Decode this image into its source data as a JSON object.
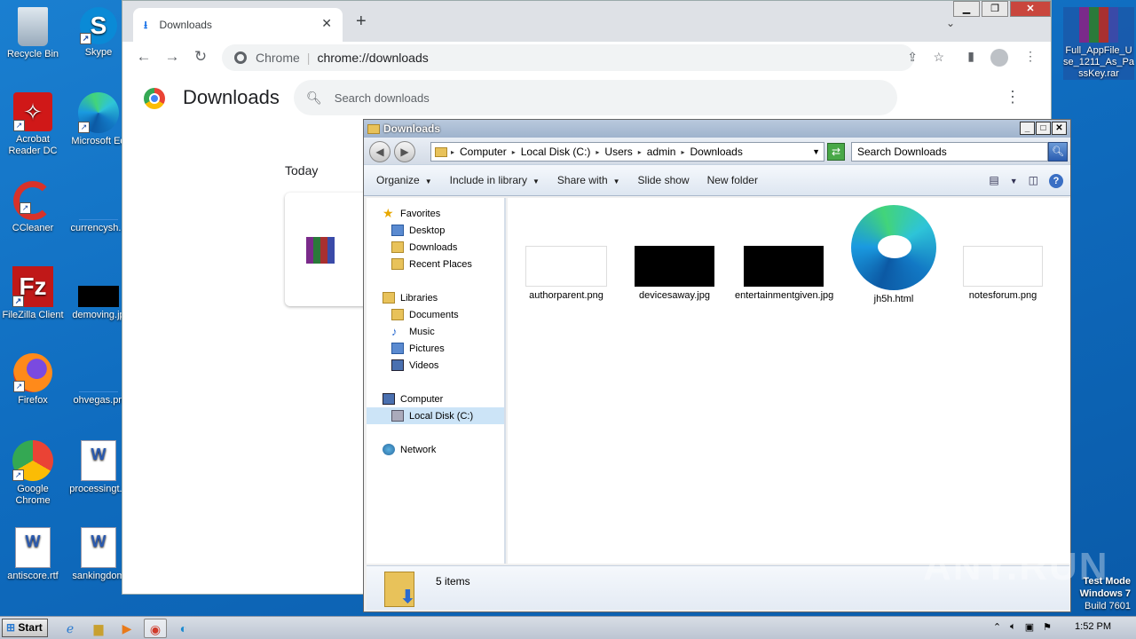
{
  "desktop": {
    "icons": [
      {
        "label": "Recycle Bin"
      },
      {
        "label": "Skype"
      },
      {
        "label": "Acrobat Reader DC"
      },
      {
        "label": "Microsoft Ed"
      },
      {
        "label": "CCleaner"
      },
      {
        "label": "currencysh..."
      },
      {
        "label": "FileZilla Client"
      },
      {
        "label": "demoving.jp"
      },
      {
        "label": "Firefox"
      },
      {
        "label": "ohvegas.pn"
      },
      {
        "label": "Google Chrome"
      },
      {
        "label": "processingt..."
      },
      {
        "label": "antiscore.rtf"
      },
      {
        "label": "sankingdom"
      },
      {
        "label": "Full_AppFile_Use_1211_As_PassKey.rar"
      }
    ],
    "watermark": "ANY.RUN",
    "test_mode": {
      "line1": "Test Mode",
      "line2": "Windows 7",
      "line3": "Build 7601"
    }
  },
  "chrome": {
    "tab_title": "Downloads",
    "omnibox_site": "Chrome",
    "omnibox_url": "chrome://downloads",
    "page_title": "Downloads",
    "search_placeholder": "Search downloads",
    "section_date": "Today"
  },
  "explorer": {
    "title": "Downloads",
    "breadcrumb": [
      "Computer",
      "Local Disk (C:)",
      "Users",
      "admin",
      "Downloads"
    ],
    "search_placeholder": "Search Downloads",
    "commands": {
      "organize": "Organize",
      "include_library": "Include in library",
      "share_with": "Share with",
      "slide_show": "Slide show",
      "new_folder": "New folder"
    },
    "nav": {
      "favorites": "Favorites",
      "desktop": "Desktop",
      "downloads": "Downloads",
      "recent_places": "Recent Places",
      "libraries": "Libraries",
      "documents": "Documents",
      "music": "Music",
      "pictures": "Pictures",
      "videos": "Videos",
      "computer": "Computer",
      "local_disk": "Local Disk (C:)",
      "network": "Network"
    },
    "files": [
      {
        "name": "authorparent.png"
      },
      {
        "name": "devicesaway.jpg"
      },
      {
        "name": "entertainmentgiven.jpg"
      },
      {
        "name": "jh5h.html"
      },
      {
        "name": "notesforum.png"
      }
    ],
    "item_count": "5 items"
  },
  "taskbar": {
    "start_label": "Start",
    "clock": "1:52 PM"
  }
}
